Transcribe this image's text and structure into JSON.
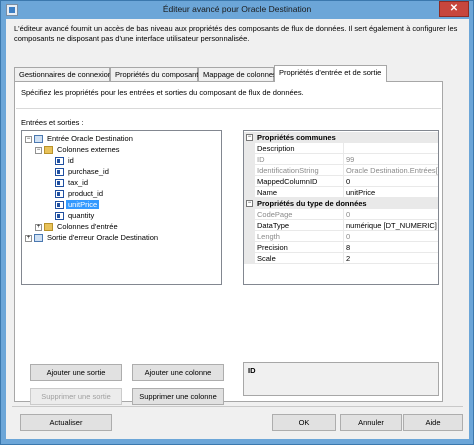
{
  "window": {
    "title": "Éditeur avancé pour Oracle Destination",
    "close_glyph": "✕"
  },
  "intro": "L'éditeur avancé fournit un accès de bas niveau aux propriétés des composants de flux de données. Il sert également à configurer les composants ne disposant pas d'une interface utilisateur personnalisée.",
  "tabs": [
    {
      "label": "Gestionnaires de connexions"
    },
    {
      "label": "Propriétés du composant"
    },
    {
      "label": "Mappage de colonnes"
    },
    {
      "label": "Propriétés d'entrée et de sortie"
    }
  ],
  "active_tab": 3,
  "panel": {
    "description": "Spécifiez les propriétés pour les entrées et sorties du composant de flux de données.",
    "io_label": "Entrées et sorties :"
  },
  "tree": {
    "root": "Entrée Oracle Destination",
    "external_columns": "Colonnes externes",
    "columns": [
      "id",
      "purchase_id",
      "tax_id",
      "product_id",
      "unitPrice",
      "quantity"
    ],
    "selected_column": "unitPrice",
    "input_columns": "Colonnes d'entrée",
    "error_output": "Sortie d'erreur Oracle Destination",
    "expanded_glyph": "−",
    "collapsed_glyph": "+"
  },
  "buttons": {
    "add_output": "Ajouter une sortie",
    "add_column": "Ajouter une colonne",
    "remove_output": "Supprimer une sortie",
    "remove_column": "Supprimer une colonne"
  },
  "properties": {
    "common_title": "Propriétés communes",
    "common_rows": [
      {
        "name": "Description",
        "value": "",
        "readonly": false
      },
      {
        "name": "ID",
        "value": "99",
        "readonly": true
      },
      {
        "name": "IdentificationString",
        "value": "Oracle Destination.Entrées[Entrée O",
        "readonly": true
      },
      {
        "name": "MappedColumnID",
        "value": "0",
        "readonly": false
      },
      {
        "name": "Name",
        "value": "unitPrice",
        "readonly": false
      }
    ],
    "datatype_title": "Propriétés du type de données",
    "datatype_rows": [
      {
        "name": "CodePage",
        "value": "0",
        "readonly": true
      },
      {
        "name": "DataType",
        "value": "numérique [DT_NUMERIC]",
        "readonly": false
      },
      {
        "name": "Length",
        "value": "0",
        "readonly": true
      },
      {
        "name": "Precision",
        "value": "8",
        "readonly": false
      },
      {
        "name": "Scale",
        "value": "2",
        "readonly": false
      }
    ],
    "collapse_glyph": "−"
  },
  "description_box": {
    "title": "ID"
  },
  "footer": {
    "refresh": "Actualiser",
    "ok": "OK",
    "cancel": "Annuler",
    "help": "Aide"
  }
}
